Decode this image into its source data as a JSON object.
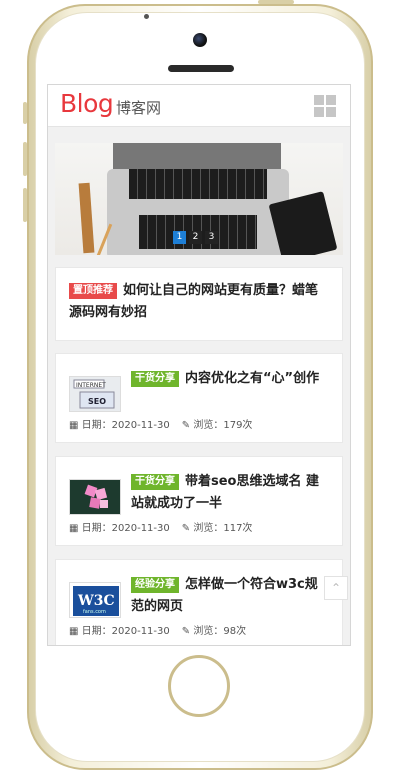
{
  "header": {
    "logo_text": "Blog",
    "logo_sub": "博客网"
  },
  "banner": {
    "pager": [
      "1",
      "2",
      "3"
    ],
    "active_page": 1
  },
  "top_post": {
    "tag": "置顶推荐",
    "title": "如何让自己的网站更有质量？蜡笔源码网有妙招"
  },
  "posts": [
    {
      "tag": "干货分享",
      "title": "内容优化之有“心”创作",
      "date_label": "日期：2020-11-30",
      "views_label": "浏览：179次",
      "thumb": "seo-internet-icon"
    },
    {
      "tag": "干货分享",
      "title": "带着seo思维选域名 建站就成功了一半",
      "date_label": "日期：2020-11-30",
      "views_label": "浏览：117次",
      "thumb": "sticky-notes-icon"
    },
    {
      "tag": "经验分享",
      "title": "怎样做一个符合w3c规范的网页",
      "date_label": "日期：2020-11-30",
      "views_label": "浏览：98次",
      "thumb": "w3c-logo-icon"
    }
  ],
  "colors": {
    "logo": "#e8383d",
    "tag_top": "#e84a4a",
    "tag_share": "#6fb52c"
  },
  "icons": {
    "calendar": "calendar-icon",
    "views": "pen-icon",
    "menu": "grid-menu-icon",
    "back_to_top": "chevron-up-icon"
  }
}
